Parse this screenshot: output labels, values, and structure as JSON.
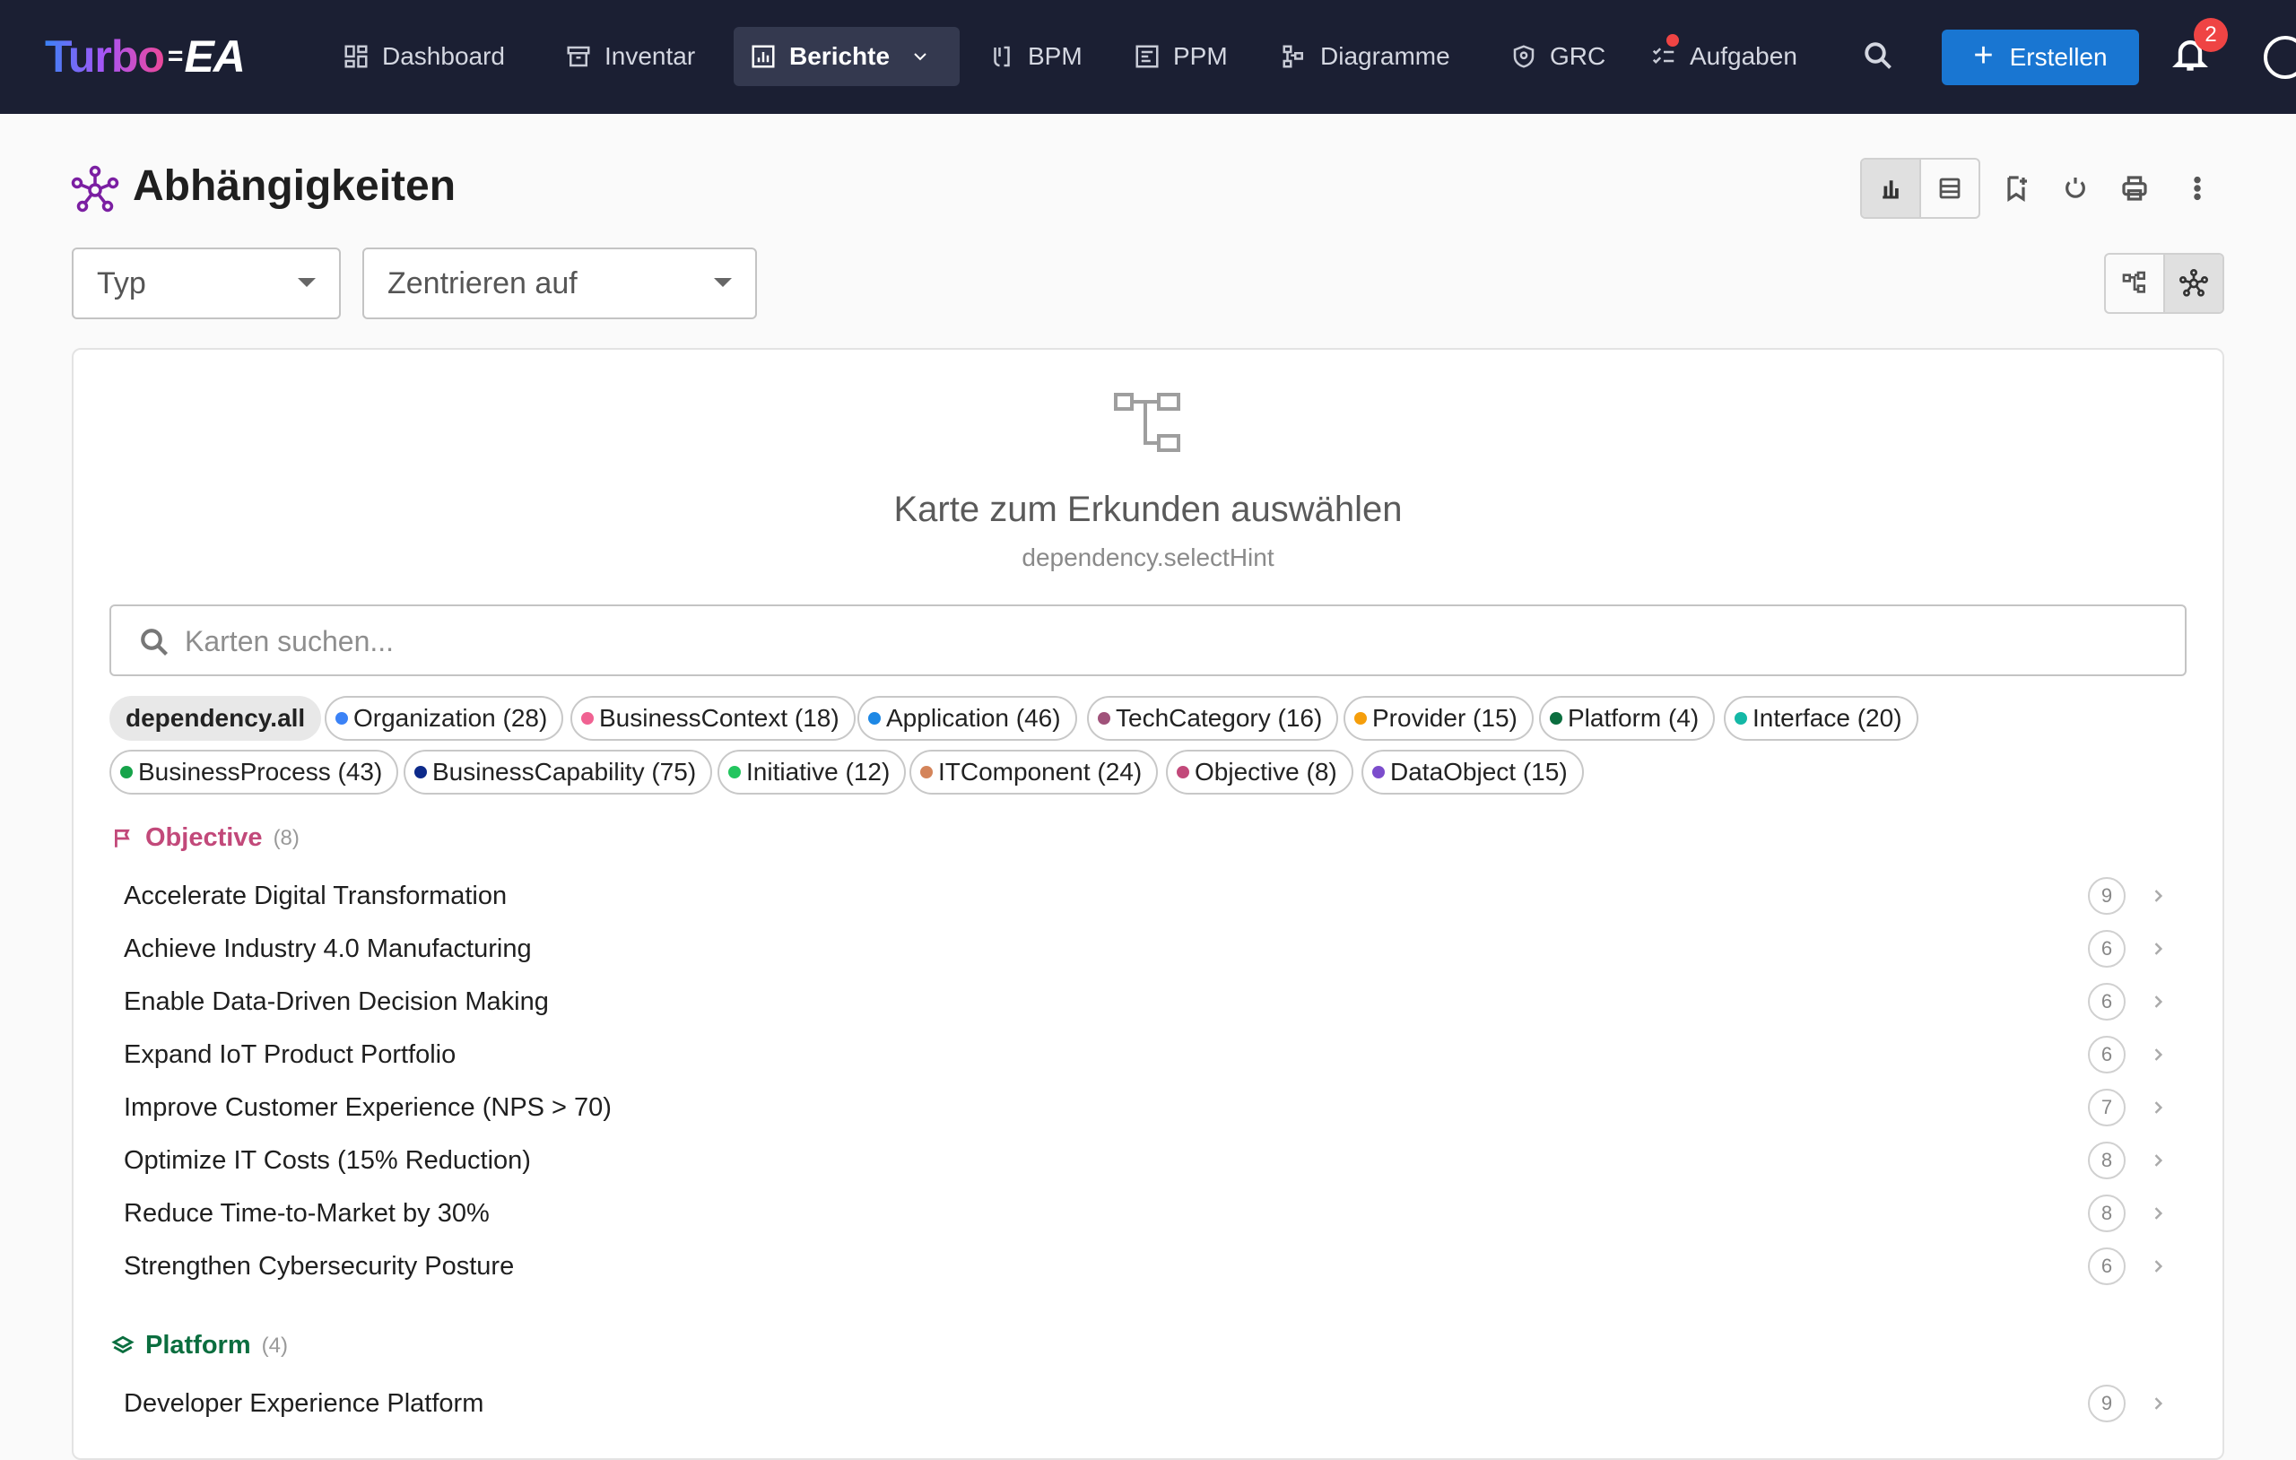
{
  "app": {
    "logo_left": "Turbo",
    "logo_right": "EA"
  },
  "nav": [
    {
      "label": "Dashboard",
      "icon": "dashboard-icon"
    },
    {
      "label": "Inventar",
      "icon": "archive-icon"
    },
    {
      "label": "Berichte",
      "icon": "report-icon",
      "active": true
    },
    {
      "label": "BPM",
      "icon": "flow-icon"
    },
    {
      "label": "PPM",
      "icon": "project-icon"
    },
    {
      "label": "Diagramme",
      "icon": "diagram-icon"
    },
    {
      "label": "GRC",
      "icon": "shield-icon"
    },
    {
      "label": "Aufgaben",
      "icon": "tasks-icon"
    }
  ],
  "topbar": {
    "create_label": "Erstellen",
    "notifications_count": "2"
  },
  "page": {
    "title": "Abhängigkeiten"
  },
  "filters": {
    "type_placeholder": "Typ",
    "center_placeholder": "Zentrieren auf"
  },
  "empty": {
    "title": "Karte zum Erkunden auswählen",
    "hint": "dependency.selectHint"
  },
  "search": {
    "placeholder": "Karten suchen..."
  },
  "chips": [
    {
      "label": "dependency.all",
      "color": null
    },
    {
      "label": "Organization (28)",
      "color": "#3b82f6"
    },
    {
      "label": "BusinessContext (18)",
      "color": "#f06292"
    },
    {
      "label": "Application (46)",
      "color": "#1e88e5"
    },
    {
      "label": "TechCategory (16)",
      "color": "#a0527a"
    },
    {
      "label": "Provider (15)",
      "color": "#f59e0b"
    },
    {
      "label": "Platform (4)",
      "color": "#0b6e3f"
    },
    {
      "label": "Interface (20)",
      "color": "#14b8a6"
    },
    {
      "label": "BusinessProcess (43)",
      "color": "#16a34a"
    },
    {
      "label": "BusinessCapability (75)",
      "color": "#0d2a8a"
    },
    {
      "label": "Initiative (12)",
      "color": "#22c55e"
    },
    {
      "label": "ITComponent (24)",
      "color": "#d4845a"
    },
    {
      "label": "Objective (8)",
      "color": "#c2497a"
    },
    {
      "label": "DataObject (15)",
      "color": "#7c4dcc"
    }
  ],
  "groups": [
    {
      "name": "Objective",
      "count": "(8)",
      "color": "#c2497a",
      "icon": "flag-icon",
      "items": [
        {
          "name": "Accelerate Digital Transformation",
          "n": "9"
        },
        {
          "name": "Achieve Industry 4.0 Manufacturing",
          "n": "6"
        },
        {
          "name": "Enable Data-Driven Decision Making",
          "n": "6"
        },
        {
          "name": "Expand IoT Product Portfolio",
          "n": "6"
        },
        {
          "name": "Improve Customer Experience (NPS > 70)",
          "n": "7"
        },
        {
          "name": "Optimize IT Costs (15% Reduction)",
          "n": "8"
        },
        {
          "name": "Reduce Time-to-Market by 30%",
          "n": "8"
        },
        {
          "name": "Strengthen Cybersecurity Posture",
          "n": "6"
        }
      ]
    },
    {
      "name": "Platform",
      "count": "(4)",
      "color": "#0b6e3f",
      "icon": "layers-icon",
      "items": [
        {
          "name": "Developer Experience Platform",
          "n": "9"
        }
      ]
    }
  ]
}
